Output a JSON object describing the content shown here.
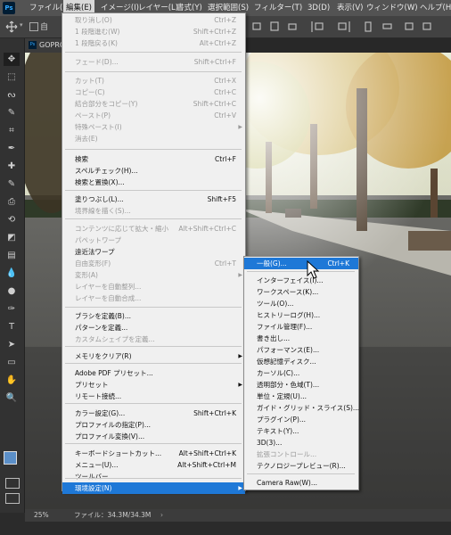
{
  "app": {
    "logo": "Ps"
  },
  "menubar": {
    "items": [
      {
        "label": "ファイル(F)",
        "active": false
      },
      {
        "label": "編集(E)",
        "active": true
      },
      {
        "label": "イメージ(I)",
        "active": false
      },
      {
        "label": "レイヤー(L)",
        "active": false
      },
      {
        "label": "書式(Y)",
        "active": false
      },
      {
        "label": "選択範囲(S)",
        "active": false
      },
      {
        "label": "フィルター(T)",
        "active": false
      },
      {
        "label": "3D(D)",
        "active": false
      },
      {
        "label": "表示(V)",
        "active": false
      },
      {
        "label": "ウィンドウ(W)",
        "active": false
      },
      {
        "label": "ヘルプ(H)",
        "active": false
      }
    ]
  },
  "document": {
    "tab_label": "GOPRO",
    "tab_icon": "Ps"
  },
  "status": {
    "zoom": "25%",
    "file_info": "ファイル：34.3M/34.3M"
  },
  "edit_menu": {
    "items": [
      {
        "label": "取り消し(O)",
        "shortcut": "Ctrl+Z",
        "disabled": true
      },
      {
        "label": "1 段階進む(W)",
        "shortcut": "Shift+Ctrl+Z",
        "disabled": true
      },
      {
        "label": "1 段階戻る(K)",
        "shortcut": "Alt+Ctrl+Z",
        "disabled": true
      },
      {
        "label": "フェード(D)...",
        "shortcut": "Shift+Ctrl+F",
        "disabled": true
      },
      {
        "label": "カット(T)",
        "shortcut": "Ctrl+X",
        "disabled": true
      },
      {
        "label": "コピー(C)",
        "shortcut": "Ctrl+C",
        "disabled": true
      },
      {
        "label": "結合部分をコピー(Y)",
        "shortcut": "Shift+Ctrl+C",
        "disabled": true
      },
      {
        "label": "ペースト(P)",
        "shortcut": "Ctrl+V",
        "disabled": true
      },
      {
        "label": "特殊ペースト(I)",
        "shortcut": "",
        "disabled": true,
        "submenu": true
      },
      {
        "label": "消去(E)",
        "shortcut": "",
        "disabled": true
      },
      {
        "label": "検索",
        "shortcut": "Ctrl+F",
        "disabled": false
      },
      {
        "label": "スペルチェック(H)...",
        "shortcut": "",
        "disabled": false
      },
      {
        "label": "検索と置換(X)...",
        "shortcut": "",
        "disabled": false
      },
      {
        "label": "塗りつぶし(L)...",
        "shortcut": "Shift+F5",
        "disabled": false
      },
      {
        "label": "境界線を描く(S)...",
        "shortcut": "",
        "disabled": true
      },
      {
        "label": "コンテンツに応じて拡大・縮小",
        "shortcut": "Alt+Shift+Ctrl+C",
        "disabled": true
      },
      {
        "label": "パペットワープ",
        "shortcut": "",
        "disabled": true
      },
      {
        "label": "遠近法ワープ",
        "shortcut": "",
        "disabled": false
      },
      {
        "label": "自由変形(F)",
        "shortcut": "Ctrl+T",
        "disabled": true
      },
      {
        "label": "変形(A)",
        "shortcut": "",
        "disabled": true,
        "submenu": true
      },
      {
        "label": "レイヤーを自動整列...",
        "shortcut": "",
        "disabled": true
      },
      {
        "label": "レイヤーを自動合成...",
        "shortcut": "",
        "disabled": true
      },
      {
        "label": "ブラシを定義(B)...",
        "shortcut": "",
        "disabled": false
      },
      {
        "label": "パターンを定義...",
        "shortcut": "",
        "disabled": false
      },
      {
        "label": "カスタムシェイプを定義...",
        "shortcut": "",
        "disabled": true
      },
      {
        "label": "メモリをクリア(R)",
        "shortcut": "",
        "disabled": false,
        "submenu": true
      },
      {
        "label": "Adobe PDF プリセット...",
        "shortcut": "",
        "disabled": false
      },
      {
        "label": "プリセット",
        "shortcut": "",
        "disabled": false,
        "submenu": true
      },
      {
        "label": "リモート接続...",
        "shortcut": "",
        "disabled": false
      },
      {
        "label": "カラー設定(G)...",
        "shortcut": "Shift+Ctrl+K",
        "disabled": false
      },
      {
        "label": "プロファイルの指定(P)...",
        "shortcut": "",
        "disabled": false
      },
      {
        "label": "プロファイル変換(V)...",
        "shortcut": "",
        "disabled": false
      },
      {
        "label": "キーボードショートカット...",
        "shortcut": "Alt+Shift+Ctrl+K",
        "disabled": false
      },
      {
        "label": "メニュー(U)...",
        "shortcut": "Alt+Shift+Ctrl+M",
        "disabled": false
      },
      {
        "label": "ツールバー...",
        "shortcut": "",
        "disabled": false
      },
      {
        "label": "環境設定(N)",
        "shortcut": "",
        "disabled": false,
        "submenu": true,
        "highlighted": true
      }
    ]
  },
  "prefs_menu": {
    "items": [
      {
        "label": "一般(G)...",
        "shortcut": "Ctrl+K",
        "disabled": false,
        "highlighted": true
      },
      {
        "label": "インターフェイス(I)...",
        "shortcut": "",
        "disabled": false
      },
      {
        "label": "ワークスペース(K)...",
        "shortcut": "",
        "disabled": false
      },
      {
        "label": "ツール(O)...",
        "shortcut": "",
        "disabled": false
      },
      {
        "label": "ヒストリーログ(H)...",
        "shortcut": "",
        "disabled": false
      },
      {
        "label": "ファイル管理(F)...",
        "shortcut": "",
        "disabled": false
      },
      {
        "label": "書き出し...",
        "shortcut": "",
        "disabled": false
      },
      {
        "label": "パフォーマンス(E)...",
        "shortcut": "",
        "disabled": false
      },
      {
        "label": "仮想記憶ディスク...",
        "shortcut": "",
        "disabled": false
      },
      {
        "label": "カーソル(C)...",
        "shortcut": "",
        "disabled": false
      },
      {
        "label": "透明部分・色域(T)...",
        "shortcut": "",
        "disabled": false
      },
      {
        "label": "単位・定規(U)...",
        "shortcut": "",
        "disabled": false
      },
      {
        "label": "ガイド・グリッド・スライス(S)...",
        "shortcut": "",
        "disabled": false
      },
      {
        "label": "プラグイン(P)...",
        "shortcut": "",
        "disabled": false
      },
      {
        "label": "テキスト(Y)...",
        "shortcut": "",
        "disabled": false
      },
      {
        "label": "3D(3)...",
        "shortcut": "",
        "disabled": false
      },
      {
        "label": "拡張コントロール...",
        "shortcut": "",
        "disabled": true
      },
      {
        "label": "テクノロジープレビュー(R)...",
        "shortcut": "",
        "disabled": false
      },
      {
        "label": "Camera Raw(W)...",
        "shortcut": "",
        "disabled": false
      }
    ]
  },
  "colors": {
    "accent": "#1e78d7",
    "menubar": "#535353",
    "menu_bg": "#f0f0f0",
    "disabled_text": "#9a9a9a",
    "fg_swatch": "#5b8fc8",
    "bg_swatch": "#ffffff"
  },
  "tools": [
    "move-icon",
    "marquee-icon",
    "lasso-icon",
    "quick-select-icon",
    "crop-icon",
    "eyedropper-icon",
    "healing-brush-icon",
    "brush-icon",
    "clone-stamp-icon",
    "history-brush-icon",
    "eraser-icon",
    "gradient-icon",
    "blur-icon",
    "dodge-icon",
    "pen-icon",
    "type-icon",
    "path-select-icon",
    "rectangle-icon",
    "hand-icon",
    "zoom-icon"
  ]
}
